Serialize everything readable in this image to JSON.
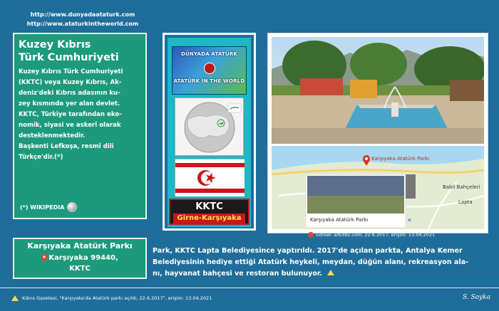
{
  "header": {
    "url_1": "http://www.dunyadaataturk.com",
    "url_2": "http://www.ataturkintheworld.com"
  },
  "wiki_panel": {
    "title_line_1": "Kuzey Kıbrıs",
    "title_line_2": "Türk Cumhuriyeti",
    "body_lines": [
      "Kuzey Kıbrıs Türk Cumhuriyeti",
      "(KKTC) veya Kuzey Kıbrıs, Ak-",
      "deniz'deki Kıbrıs adasının ku-",
      "zey kısmında yer alan devlet.",
      "KKTC, Türkiye tarafından eko-",
      "nomik, siyasi ve askerî olarak",
      "desteklenmektedir.",
      "Başkenti Lefkoşa, resmî dili",
      "Türkçe'dir.(*)"
    ],
    "source_label": "(*) WIKIPEDIA"
  },
  "center_column": {
    "logo_top_text": "DÜNYADA ATATÜRK",
    "logo_bottom_text": "ATATÜRK IN THE WORLD",
    "country_code": "KKTC",
    "location_label": "Girne-Karşıyaka"
  },
  "photo": {
    "map_pin_label": "Karşıyaka Atatürk Parkı",
    "map_place_1": "Lapta",
    "map_place_2": "Babil Bahçeleri",
    "map_card_title": "Karşıyaka Atatürk Parkı",
    "credit": "Görsel: arb392.com, 22.6.2017, erişim: 13.04.2021"
  },
  "location": {
    "title": "Karşıyaka Atatürk Parkı",
    "address_line": "Karşıyaka 99440,",
    "country": "KKTC"
  },
  "description": {
    "lines": [
      "Park, KKTC Lapta Belediyesince yaptırıldı. 2017'de açılan parkta, Antalya Kemer",
      "Belediyesinin hediye ettiği Atatürk heykeli, meydan, düğün alanı, rekreasyon ala-",
      "nı, hayvanat bahçesi ve restoran bulunuyor."
    ]
  },
  "footer": {
    "source_text": "Kıbrıs Gazetesi, \"Karşıyaka'da Atatürk parkı açıldı, 22.6.2017\", erişim: 13.04.2021",
    "signature": "S. Soyka"
  },
  "colors": {
    "background": "#1f6d9a",
    "panel_green": "#1d9a7c",
    "center_cyan": "#1db7c5",
    "flag_red": "#c9171c"
  }
}
